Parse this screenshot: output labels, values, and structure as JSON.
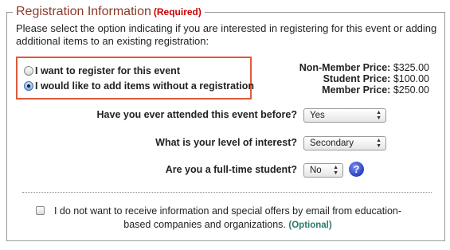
{
  "legend": {
    "title": "Registration Information",
    "required": "(Required)"
  },
  "intro": "Please select the option indicating if you are interested in registering for this event or adding additional items to an existing registration:",
  "options": [
    {
      "label": "I want to register for this event",
      "checked": false
    },
    {
      "label": "I would like to add items without a registration",
      "checked": true
    }
  ],
  "prices": [
    {
      "label": "Non-Member Price:",
      "value": "$325.00"
    },
    {
      "label": "Student Price:",
      "value": "$100.00"
    },
    {
      "label": "Member Price:",
      "value": "$250.00"
    }
  ],
  "questions": {
    "attended": {
      "label": "Have you ever attended this event before?",
      "value": "Yes"
    },
    "interest": {
      "label": "What is your level of interest?",
      "value": "Secondary"
    },
    "student": {
      "label": "Are you a full-time student?",
      "value": "No"
    }
  },
  "help_icon": "?",
  "optout": {
    "text": "I do not want to receive information and special offers by email from education-based companies and organizations.",
    "optional": "(Optional)",
    "checked": false
  },
  "colors": {
    "legend": "#8b3a2a",
    "required": "#cc0000",
    "highlight_border": "#e05a3a",
    "optional": "#2a7a6a",
    "help": "#2a3fc4"
  }
}
